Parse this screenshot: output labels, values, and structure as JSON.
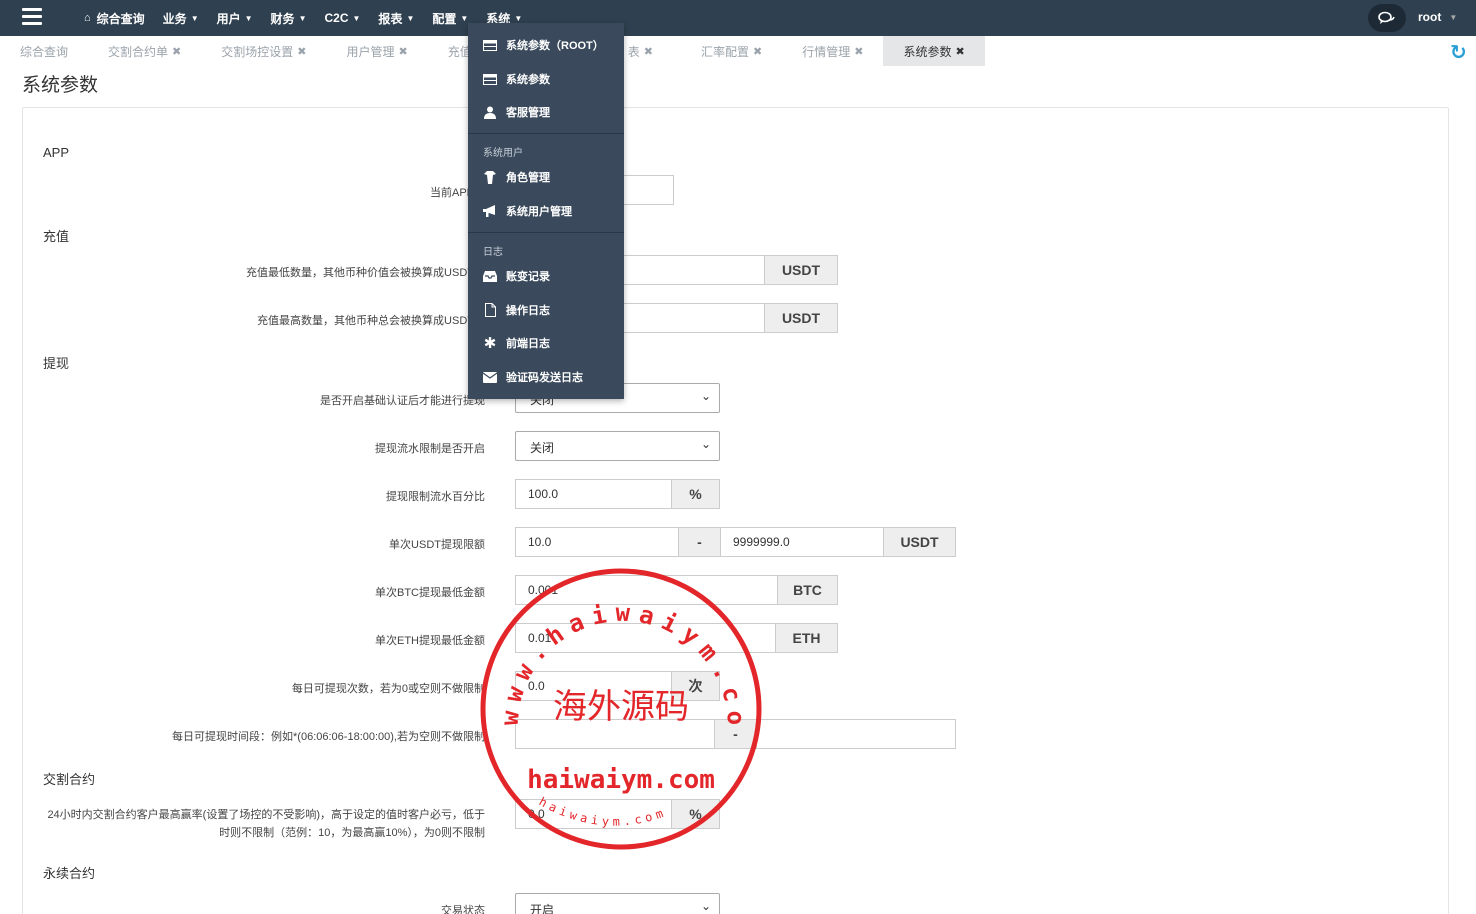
{
  "nav": {
    "items": [
      {
        "label": "综合查询",
        "home": true,
        "caret": false
      },
      {
        "label": "业务",
        "caret": true
      },
      {
        "label": "用户",
        "caret": true
      },
      {
        "label": "财务",
        "caret": true
      },
      {
        "label": "C2C",
        "caret": true
      },
      {
        "label": "报表",
        "caret": true
      },
      {
        "label": "配置",
        "caret": true
      },
      {
        "label": "系统",
        "caret": true
      }
    ],
    "user": "root"
  },
  "tabs": [
    {
      "label": "综合查询",
      "closable": false
    },
    {
      "label": "交割合约单",
      "closable": true
    },
    {
      "label": "交割场控设置",
      "closable": true
    },
    {
      "label": "用户管理",
      "closable": true
    },
    {
      "label": "充值",
      "closable": false
    },
    {
      "label": "表",
      "closable": true
    },
    {
      "label": "汇率配置",
      "closable": true
    },
    {
      "label": "行情管理",
      "closable": true
    },
    {
      "label": "系统参数",
      "closable": true,
      "active": true
    }
  ],
  "page": {
    "title": "系统参数"
  },
  "sections": {
    "app": "APP",
    "recharge": "充值",
    "withdraw": "提现",
    "delivery": "交割合约",
    "perpetual": "永续合约"
  },
  "fields": {
    "app_version": {
      "label": "当前APP版"
    },
    "recharge_min": {
      "label": "充值最低数量，其他币种价值会被换算成USDT再",
      "unit": "USDT"
    },
    "recharge_max": {
      "label": "充值最高数量，其他币种总会被换算成USDT再",
      "unit": "USDT"
    },
    "withdraw_basic_auth": {
      "label": "是否开启基础认证后才能进行提现",
      "value": "关闭"
    },
    "withdraw_flow_limit": {
      "label": "提现流水限制是否开启",
      "value": "关闭"
    },
    "withdraw_flow_pct": {
      "label": "提现限制流水百分比",
      "value": "100.0",
      "unit": "%"
    },
    "usdt_limit": {
      "label": "单次USDT提现限额",
      "min": "10.0",
      "sep": "-",
      "max": "9999999.0",
      "unit": "USDT"
    },
    "btc_min": {
      "label": "单次BTC提现最低金额",
      "value": "0.001",
      "unit": "BTC"
    },
    "eth_min": {
      "label": "单次ETH提现最低金额",
      "value": "0.01",
      "unit": "ETH"
    },
    "daily_count": {
      "label": "每日可提现次数，若为0或空则不做限制",
      "value": "0.0",
      "unit": "次"
    },
    "daily_time": {
      "label": "每日可提现时间段：例如*(06:06:06-18:00:00),若为空则不做限制",
      "sep": "-"
    },
    "win_rate": {
      "label1": "24小时内交割合约客户最高赢率(设置了场控的不受影响)，高于设定的值时客户必亏，低于",
      "label2": "时则不限制（范例：10，为最高赢10%），为0则不限制",
      "value": "0.0",
      "unit": "%"
    },
    "trade_status": {
      "label": "交易状态",
      "value": "开启"
    }
  },
  "dropdown": {
    "items": [
      {
        "label": "系统参数（ROOT）",
        "icon": "table-icon"
      },
      {
        "label": "系统参数",
        "icon": "table-icon"
      },
      {
        "label": "客服管理",
        "icon": "user-icon"
      }
    ],
    "group1": "系统用户",
    "group1_items": [
      {
        "label": "角色管理",
        "icon": "shirt-icon"
      },
      {
        "label": "系统用户管理",
        "icon": "bullhorn-icon"
      }
    ],
    "group2": "日志",
    "group2_items": [
      {
        "label": "账变记录",
        "icon": "inbox-icon"
      },
      {
        "label": "操作日志",
        "icon": "file-icon"
      },
      {
        "label": "前端日志",
        "icon": "asterisk-icon"
      },
      {
        "label": "验证码发送日志",
        "icon": "envelope-icon"
      }
    ]
  },
  "stamp": {
    "ring_text": "www.haiwaiym.com",
    "center_text": "海外源码",
    "bottom_text": "haiwaiym.com",
    "small_text": "haiwaiym.com",
    "color": "#e3262a"
  }
}
